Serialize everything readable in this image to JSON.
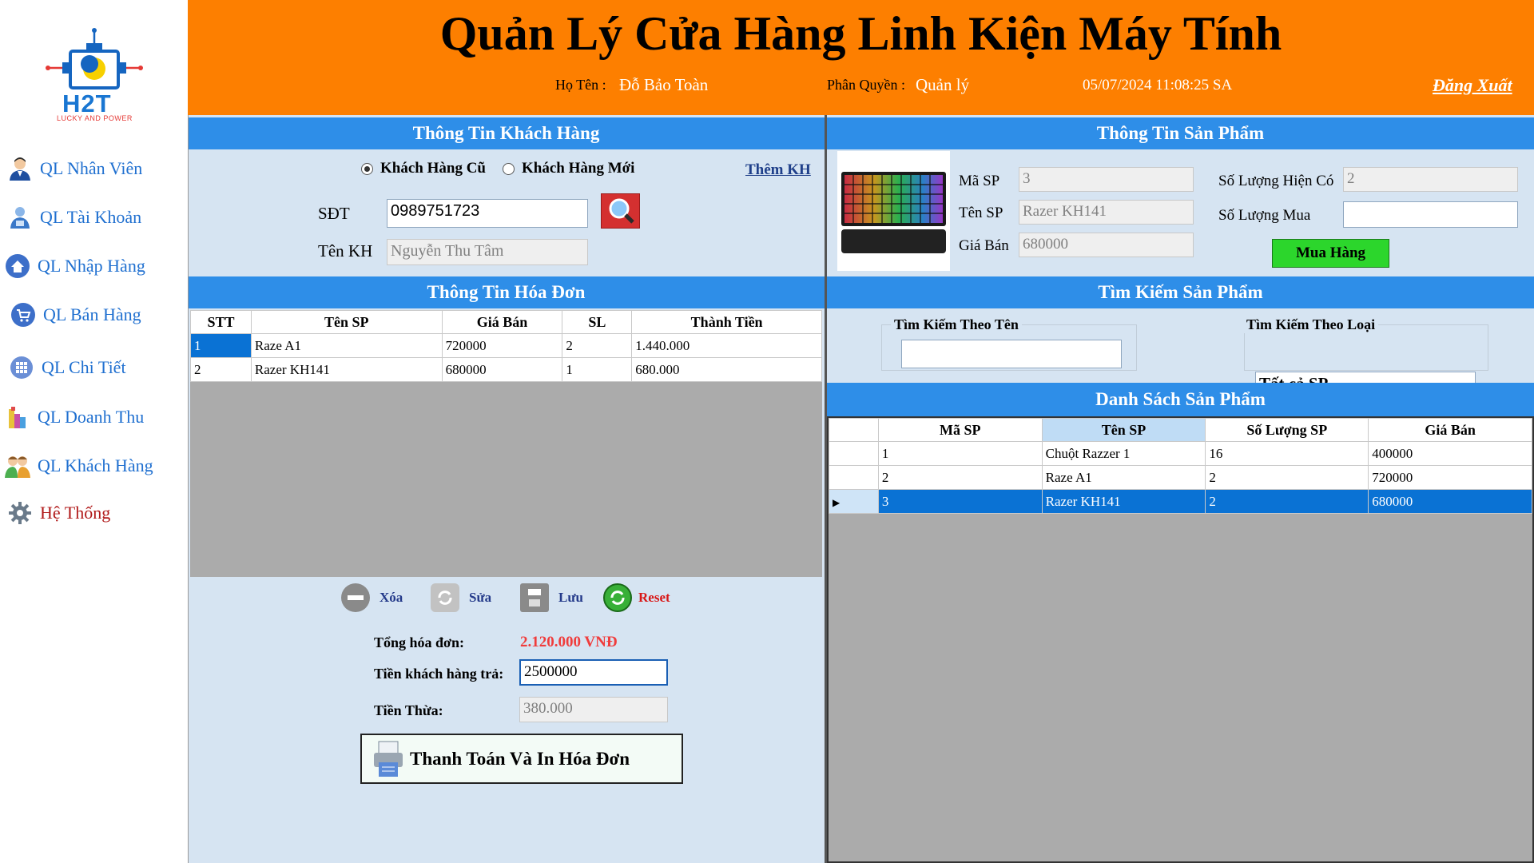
{
  "app": {
    "logo_text": "H2T",
    "logo_sub": "LUCKY AND POWER",
    "title": "Quản Lý Cửa Hàng Linh Kiện Máy Tính"
  },
  "header": {
    "name_label": "Họ Tên :",
    "name_value": "Đỗ Bảo Toàn",
    "role_label": "Phân Quyền :",
    "role_value": "Quản lý",
    "datetime": "05/07/2024 11:08:25 SA",
    "logout": "Đăng Xuất"
  },
  "sidebar": {
    "items": [
      {
        "label": "QL Nhân Viên",
        "icon": "employee-icon"
      },
      {
        "label": "QL Tài Khoản",
        "icon": "account-icon"
      },
      {
        "label": "QL Nhập Hàng",
        "icon": "import-icon"
      },
      {
        "label": "QL Bán Hàng",
        "icon": "cart-icon"
      },
      {
        "label": "QL Chi Tiết",
        "icon": "grid-icon"
      },
      {
        "label": "QL Doanh Thu",
        "icon": "revenue-icon"
      },
      {
        "label": "QL Khách Hàng",
        "icon": "customers-icon"
      },
      {
        "label": "Hệ Thống",
        "icon": "gear-icon"
      }
    ]
  },
  "customer": {
    "title": "Thông Tin Khách Hàng",
    "radio_old": "Khách Hàng Cũ",
    "radio_new": "Khách Hàng Mới",
    "add_link": "Thêm KH",
    "phone_label": "SĐT",
    "phone_value": "0989751723",
    "name_label": "Tên KH",
    "name_value": "Nguyễn Thu Tâm"
  },
  "invoice": {
    "title": "Thông Tin Hóa Đơn",
    "columns": [
      "STT",
      "Tên SP",
      "Giá Bán",
      "SL",
      "Thành Tiền"
    ],
    "rows": [
      [
        "1",
        "Raze A1",
        "720000",
        "2",
        "1.440.000"
      ],
      [
        "2",
        "Razer KH141",
        "680000",
        "1",
        "680.000"
      ]
    ],
    "actions": {
      "delete": "Xóa",
      "edit": "Sửa",
      "save": "Lưu",
      "reset": "Reset"
    },
    "total_label": "Tổng hóa đơn:",
    "total_value": "2.120.000 VNĐ",
    "paid_label": "Tiền khách hàng trả:",
    "paid_value": "2500000",
    "change_label": "Tiền Thừa:",
    "change_value": "380.000",
    "pay_button": "Thanh Toán Và In Hóa Đơn"
  },
  "product": {
    "title": "Thông Tin Sản Phẩm",
    "code_label": "Mã SP",
    "code_value": "3",
    "name_label": "Tên SP",
    "name_value": "Razer KH141",
    "price_label": "Giá Bán",
    "price_value": "680000",
    "stock_label": "Số Lượng Hiện Có",
    "stock_value": "2",
    "qty_label": "Số Lượng Mua",
    "qty_value": "",
    "buy_button": "Mua Hàng"
  },
  "search": {
    "title": "Tìm Kiếm Sản Phẩm",
    "by_name_label": "Tìm Kiếm Theo Tên",
    "by_name_value": "",
    "by_type_label": "Tìm Kiếm Theo Loại",
    "by_type_value": "Tất cả SP"
  },
  "product_list": {
    "title": "Danh Sách Sản Phẩm",
    "columns": [
      "Mã SP",
      "Tên SP",
      "Số Lượng SP",
      "Giá Bán"
    ],
    "rows": [
      [
        "1",
        "Chuột Razzer 1",
        "16",
        "400000"
      ],
      [
        "2",
        "Raze A1",
        "2",
        "720000"
      ],
      [
        "3",
        "Razer KH141",
        "2",
        "680000"
      ]
    ],
    "selected_row": 2
  },
  "colors": {
    "header": "#fd7f00",
    "panel_title": "#2e8ee8",
    "panel_bg": "#d6e4f2",
    "selection": "#0a72d4",
    "total": "#f03c3c"
  }
}
